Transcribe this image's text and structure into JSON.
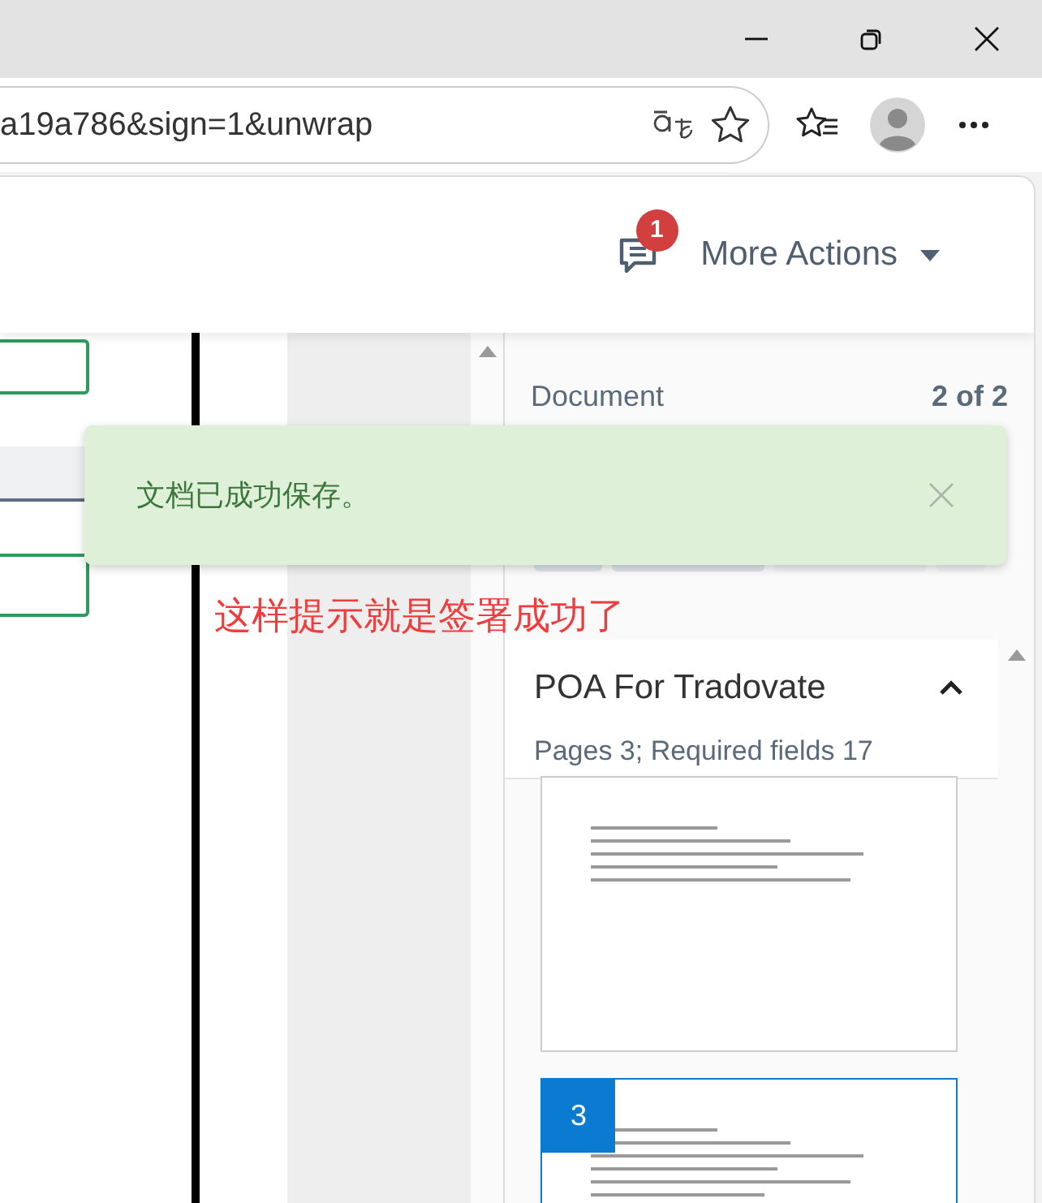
{
  "browser": {
    "address": "a19a786&sign=1&unwrap"
  },
  "header": {
    "notification_count": "1",
    "more_actions": "More Actions"
  },
  "document_panel": {
    "label": "Document",
    "count": "2 of 2",
    "title": "POA For Tradovate",
    "expanded": true,
    "summary": "Pages 3; Required fields 17",
    "pages": [
      {
        "selected": false
      },
      {
        "number": "3",
        "selected": true
      }
    ]
  },
  "toast": {
    "message": "文档已成功保存。"
  },
  "annotation": "这样提示就是签署成功了"
}
